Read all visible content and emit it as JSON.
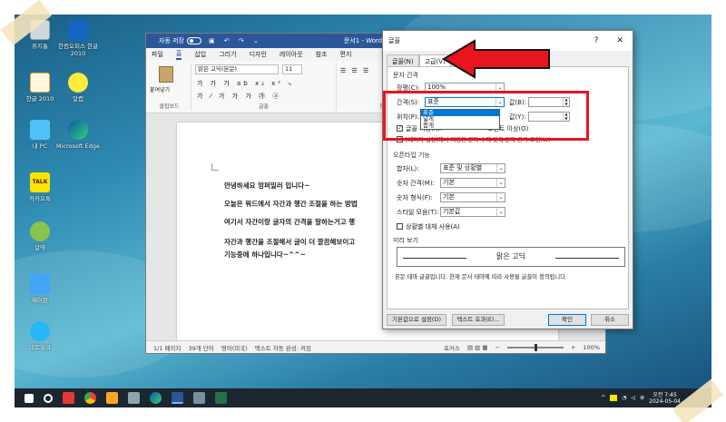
{
  "desktop": {
    "icons": [
      {
        "label": "휴지통",
        "icon": "recycle-bin-icon"
      },
      {
        "label": "한컴오피스 한글 2010",
        "icon": "hancom-office-icon"
      },
      {
        "label": "한글 2010",
        "icon": "hangul-doc-icon"
      },
      {
        "label": "알캡",
        "icon": "alcapture-icon"
      },
      {
        "label": "내 PC",
        "icon": "my-pc-icon"
      },
      {
        "label": "Microsoft Edge",
        "icon": "edge-icon"
      },
      {
        "label": "카카오톡",
        "icon": "kakaotalk-icon"
      },
      {
        "label": "알약",
        "icon": "alyac-icon"
      },
      {
        "label": "제어판",
        "icon": "control-panel-icon"
      },
      {
        "label": "네트워크",
        "icon": "network-icon"
      }
    ],
    "kakao_logo": "TALK"
  },
  "word": {
    "autosave": "자동 저장",
    "doc_title": "문서1 - Word",
    "menu": [
      "파일",
      "홈",
      "삽입",
      "그리기",
      "디자인",
      "레이아웃",
      "참조",
      "편지"
    ],
    "active_menu": "홈",
    "ribbon": {
      "paste": "붙여넣기",
      "font_name": "맑은 고딕(본문)",
      "font_size": "11",
      "group_clipboard": "클립보드",
      "group_font": "글꼴",
      "group_para": "단"
    },
    "body": [
      "안녕하세요 엉퍼밀러 입니다~",
      "오늘은 워드에서 자간과 행간 조절을 하는 방법",
      "여기서 자간이랑 글자의 간격을 말하는거고 행",
      "자간과 행간을 조절해서 글이 더 깔끔해보이고",
      "기능중에 하나입니다~^^~"
    ],
    "status": {
      "page": "1/1 페이지",
      "words": "39개 단어",
      "lang": "영어(미국)",
      "predict": "텍스트 자동 완성: 켜짐",
      "focus": "포커스",
      "zoom": "100%"
    }
  },
  "dialog": {
    "title": "글꼴",
    "help": "?",
    "close": "✕",
    "tabs": [
      "글꼴(N)",
      "고급(V)"
    ],
    "selected_tab": "고급(V)",
    "spacing_section": "문자 간격",
    "scale_label": "장평(C):",
    "scale_value": "100%",
    "spacing_label": "간격(S):",
    "spacing_value": "표준",
    "spacing_options": [
      "표준",
      "넓게",
      "좁게"
    ],
    "spacing_highlight": "표준",
    "by_label": "값(B):",
    "position_label": "위치(P):",
    "position_by_label": "값(Y):",
    "kerning_label": "글꼴 커닝(K):",
    "kerning_suffix": "포인트 이상(O)",
    "grid_label": "[페이지 설정]에서 지정된 문자 수에 맞춰 문자 간격 조정(W)",
    "opentype_section": "오픈타입 기능",
    "ligatures_label": "합자(L):",
    "ligatures_value": "표준 및 상황별",
    "num_spacing_label": "숫자 간격(M):",
    "num_spacing_value": "기본",
    "num_forms_label": "숫자 형식(F):",
    "num_forms_value": "기본",
    "stylistic_label": "스타일 모음(T):",
    "stylistic_value": "기본값",
    "contextual_label": "상황별 대체 사용(A)",
    "preview_section": "미리 보기",
    "preview_text": "맑은 고딕",
    "preview_note": "본문 테마 글꼴입니다. 현재 문서 테마에 따라 사용될 글꼴이 정의됩니다.",
    "btn_default": "기본값으로 설정(D)",
    "btn_effects": "텍스트 효과(E)...",
    "btn_ok": "확인",
    "btn_cancel": "취소"
  },
  "taskbar": {
    "time": "오전 7:45",
    "date": "2024-05-04"
  },
  "colors": {
    "highlight_box": "#e8141e",
    "word_blue": "#2b579a",
    "selection": "#0078d7"
  }
}
